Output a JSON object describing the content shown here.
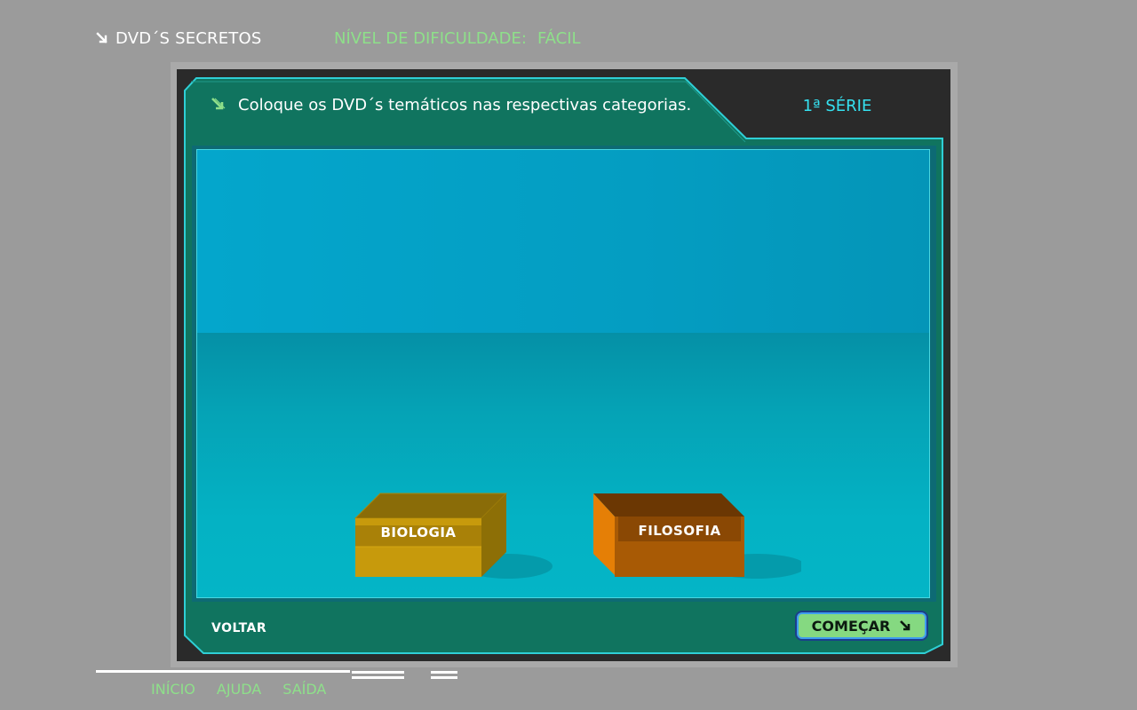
{
  "header": {
    "app_title": "DVD´S SECRETOS",
    "level_label": "NÍVEL DE DIFICULDADE:",
    "level_value": "FÁCIL"
  },
  "panel": {
    "instruction": "Coloque os DVD´s temáticos nas respectivas categorias.",
    "grade": "1ª SÉRIE"
  },
  "boxes": [
    {
      "label": "BIOLOGIA",
      "color": "#c79a0c"
    },
    {
      "label": "FILOSOFIA",
      "color": "#a85a05"
    }
  ],
  "actions": {
    "back": "VOLTAR",
    "start": "COMEÇAR"
  },
  "nav": {
    "home": "INÍCIO",
    "help": "AJUDA",
    "exit": "SAÍDA"
  },
  "colors": {
    "background": "#9b9b9b",
    "panel_green": "#10745f",
    "accent_green": "#8ee08a",
    "accent_cyan": "#35e1f0"
  }
}
